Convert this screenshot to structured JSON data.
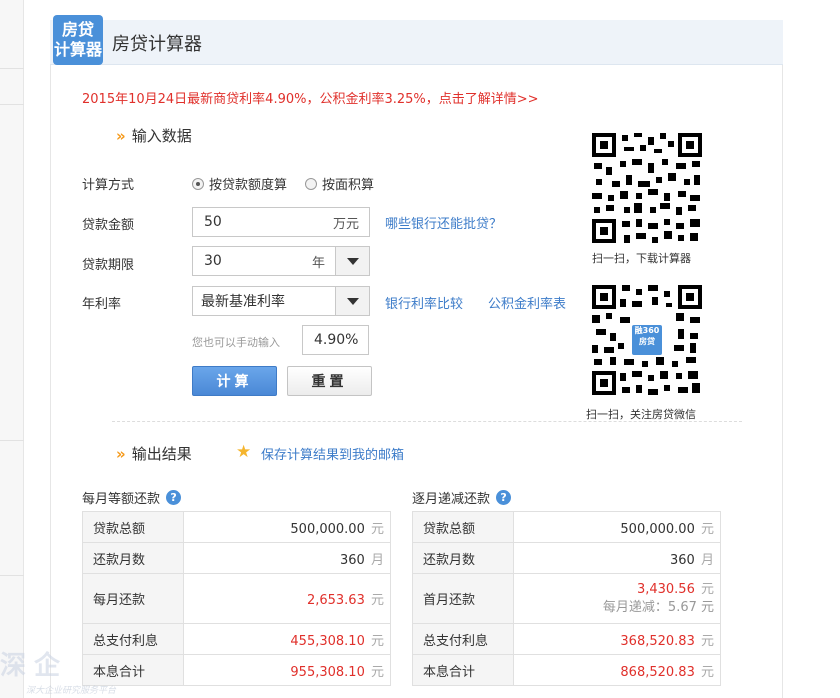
{
  "header": {
    "logo_line1": "房贷",
    "logo_line2": "计算器",
    "title": "房贷计算器"
  },
  "notice": "2015年10月24日最新商贷利率4.90%，公积金利率3.25%，点击了解详情>>",
  "input_section": {
    "arrow": "»",
    "title": "输入数据",
    "calc_method_label": "计算方式",
    "calc_method_options": [
      "按贷款额度算",
      "按面积算"
    ],
    "calc_method_selected": "按贷款额度算",
    "loan_amount_label": "贷款金额",
    "loan_amount_value": "50",
    "loan_amount_unit": "万元",
    "loan_amount_link": "哪些银行还能批贷？",
    "loan_term_label": "贷款期限",
    "loan_term_value": "30",
    "loan_term_unit": "年",
    "rate_label": "年利率",
    "rate_select_value": "最新基准利率",
    "rate_link_bank": "银行利率比较",
    "rate_link_fund": "公积金利率表",
    "manual_hint": "您也可以手动输入",
    "manual_rate_value": "4.90%",
    "calc_button": "计算",
    "reset_button": "重置"
  },
  "qr": {
    "caption1": "扫一扫，下载计算器",
    "caption2": "扫一扫，关注房贷微信",
    "badge_line1": "融360",
    "badge_line2": "房贷"
  },
  "output_section": {
    "arrow": "»",
    "title": "输出结果",
    "save_link": "保存计算结果到我的邮箱"
  },
  "equal_payment": {
    "title": "每月等额还款",
    "help": "?",
    "rows": [
      {
        "label": "贷款总额",
        "value": "500,000.00",
        "unit": "元"
      },
      {
        "label": "还款月数",
        "value": "360",
        "unit": "月"
      },
      {
        "label": "每月还款",
        "value": "2,653.63",
        "unit": "元"
      },
      {
        "label": "总支付利息",
        "value": "455,308.10",
        "unit": "元"
      },
      {
        "label": "本息合计",
        "value": "955,308.10",
        "unit": "元"
      }
    ]
  },
  "decreasing_payment": {
    "title": "逐月递减还款",
    "help": "?",
    "rows": [
      {
        "label": "贷款总额",
        "value": "500,000.00",
        "unit": "元"
      },
      {
        "label": "还款月数",
        "value": "360",
        "unit": "月"
      },
      {
        "label": "首月还款",
        "value": "3,430.56",
        "unit": "元",
        "sub": "每月递减：5.67 元"
      },
      {
        "label": "总支付利息",
        "value": "368,520.83",
        "unit": "元"
      },
      {
        "label": "本息合计",
        "value": "868,520.83",
        "unit": "元"
      }
    ]
  },
  "watermark": {
    "main": "深企",
    "sub": "深大企业研究服务平台"
  },
  "colors": {
    "accent_blue": "#4a90d9",
    "notice_red": "#e0302b",
    "link_blue": "#3d7cc9",
    "arrow_orange": "#f59a1c"
  }
}
